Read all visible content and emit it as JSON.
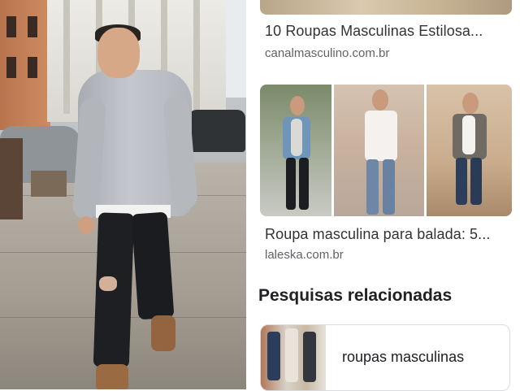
{
  "results": [
    {
      "title": "10 Roupas Masculinas Estilosa...",
      "source": "canalmasculino.com.br"
    },
    {
      "title": "Roupa masculina para balada: 5...",
      "source": "laleska.com.br"
    }
  ],
  "related": {
    "heading": "Pesquisas relacionadas",
    "items": [
      {
        "label": "roupas masculinas"
      }
    ]
  }
}
